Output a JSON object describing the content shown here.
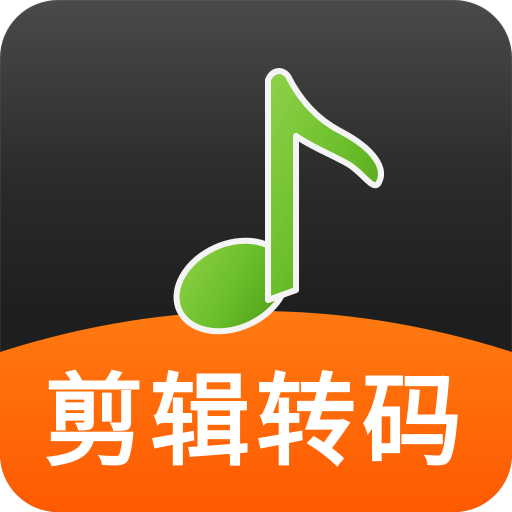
{
  "icon": {
    "caption": "剪辑转码",
    "symbol": "music-note-icon",
    "colors": {
      "background_dark": "#1f1f1f",
      "band_orange": "#ff6a0a",
      "note_green": "#6cbf2a",
      "caption_text": "#ffffff"
    }
  }
}
